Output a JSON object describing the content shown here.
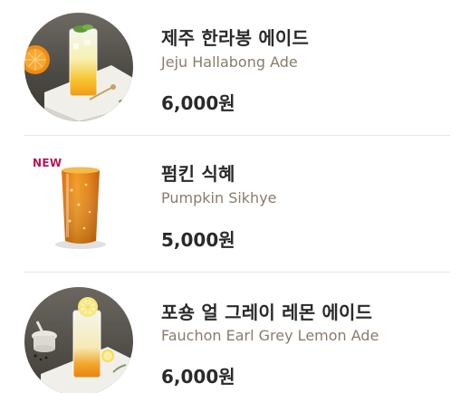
{
  "menu": {
    "items": [
      {
        "name_kr": "제주 한라봉 에이드",
        "name_en": "Jeju Hallabong Ade",
        "price": "6,000원",
        "badge": "",
        "image": "hallabong-ade-photo"
      },
      {
        "name_kr": "펌킨 식혜",
        "name_en": "Pumpkin Sikhye",
        "price": "5,000원",
        "badge": "NEW",
        "image": "pumpkin-sikhye-photo"
      },
      {
        "name_kr": "포숑 얼 그레이 레몬 에이드",
        "name_en": "Fauchon Earl Grey Lemon Ade",
        "price": "6,000원",
        "badge": "",
        "image": "earl-grey-lemon-ade-photo"
      }
    ]
  },
  "colors": {
    "name_en": "#8a7c6c",
    "badge": "#b5175a",
    "divider": "#e5e5e5"
  }
}
